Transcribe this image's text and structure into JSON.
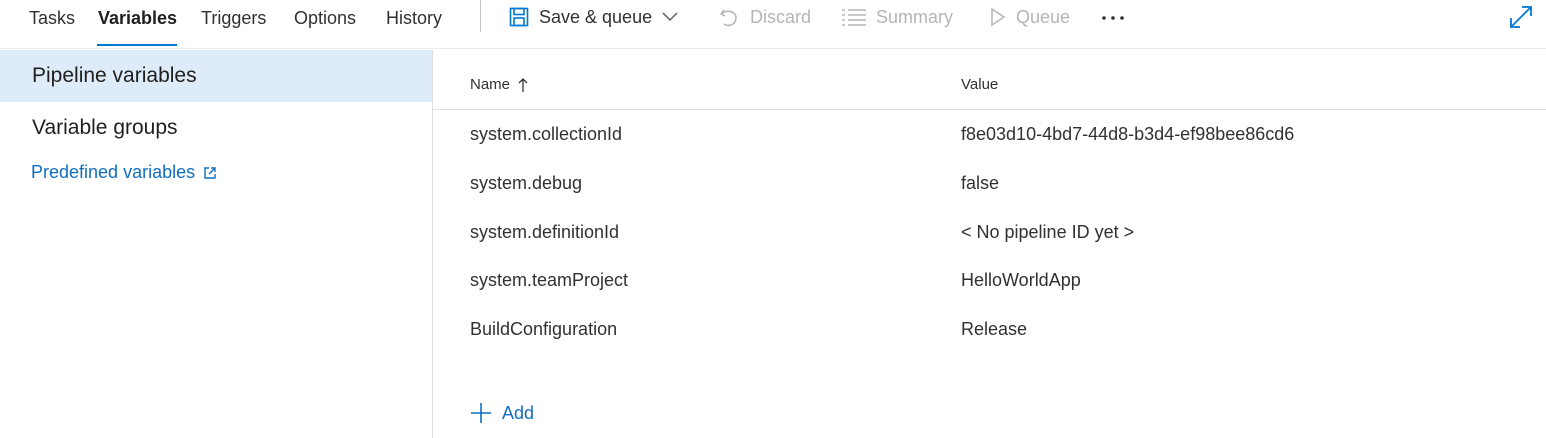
{
  "tabs": [
    {
      "label": "Tasks",
      "active": false
    },
    {
      "label": "Variables",
      "active": true
    },
    {
      "label": "Triggers",
      "active": false
    },
    {
      "label": "Options",
      "active": false
    },
    {
      "label": "History",
      "active": false
    }
  ],
  "toolbar": {
    "save_queue_label": "Save & queue",
    "discard_label": "Discard",
    "summary_label": "Summary",
    "queue_label": "Queue"
  },
  "leftnav": {
    "pipeline_variables": "Pipeline variables",
    "variable_groups": "Variable groups",
    "predefined_variables": "Predefined variables"
  },
  "grid": {
    "columns": {
      "name": "Name",
      "value": "Value"
    },
    "rows": [
      {
        "name": "system.collectionId",
        "value": "f8e03d10-4bd7-44d8-b3d4-ef98bee86cd6"
      },
      {
        "name": "system.debug",
        "value": "false"
      },
      {
        "name": "system.definitionId",
        "value": "< No pipeline ID yet >"
      },
      {
        "name": "system.teamProject",
        "value": "HelloWorldApp"
      },
      {
        "name": "BuildConfiguration",
        "value": "Release"
      }
    ],
    "add_label": "Add"
  },
  "colors": {
    "accent": "#0078d4",
    "link": "#106ebe",
    "selected_bg": "#deecf9",
    "disabled": "#b5b5b5"
  }
}
